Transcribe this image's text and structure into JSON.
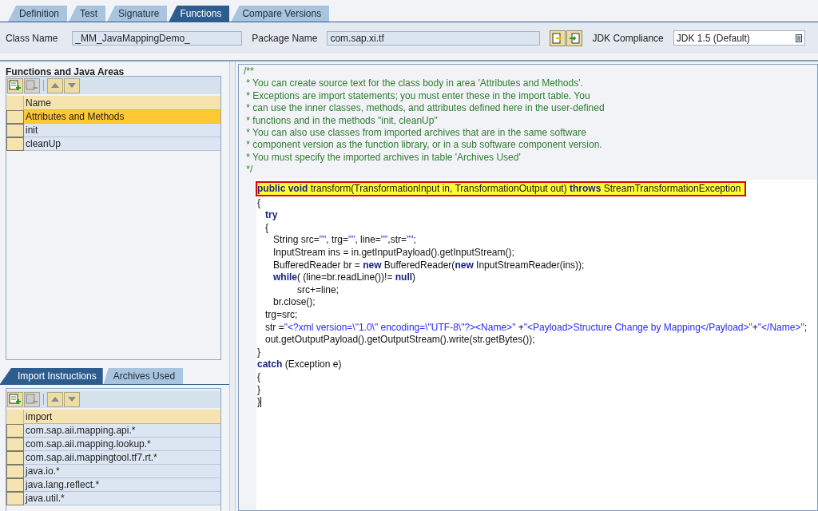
{
  "tabs": [
    {
      "label": "Definition",
      "selected": false
    },
    {
      "label": "Test",
      "selected": false
    },
    {
      "label": "Signature",
      "selected": false
    },
    {
      "label": "Functions",
      "selected": true
    },
    {
      "label": "Compare Versions",
      "selected": false
    }
  ],
  "class_name": {
    "label": "Class Name",
    "value": "_MM_JavaMappingDemo_"
  },
  "package_name": {
    "label": "Package Name",
    "value": "com.sap.xi.tf"
  },
  "jdk_compliance": {
    "label": "JDK Compliance",
    "value": "JDK 1.5 (Default)"
  },
  "functions_panel": {
    "title": "Functions and Java Areas",
    "column": "Name",
    "rows": [
      {
        "text": "Attributes and Methods",
        "selected": true
      },
      {
        "text": "init",
        "selected": false
      },
      {
        "text": "cleanUp",
        "selected": false
      }
    ]
  },
  "bottom_tabs": [
    {
      "label": "Import Instructions",
      "selected": true
    },
    {
      "label": "Archives Used",
      "selected": false
    }
  ],
  "imports": {
    "column": "import",
    "rows": [
      {
        "text": "com.sap.aii.mapping.api.*",
        "selected": false
      },
      {
        "text": "com.sap.aii.mapping.lookup.*",
        "selected": false
      },
      {
        "text": "com.sap.aii.mappingtool.tf7.rt.*",
        "selected": false
      },
      {
        "text": "java.io.*",
        "selected": false
      },
      {
        "text": "java.lang.reflect.*",
        "selected": false
      },
      {
        "text": "java.util.*",
        "selected": false
      }
    ]
  },
  "editor": {
    "comment": [
      "/**",
      " * You can create source text for the class body in area 'Attributes and Methods'.",
      " * Exceptions are import statements; you must enter these in the import table. You",
      " * can use the inner classes, methods, and attributes defined here in the user-defined",
      " * functions and in the methods \"init, cleanUp\"",
      " * You can also use classes from imported archives that are in the same software",
      " * component version as the function library, or in a sub software component version.",
      " * You must specify the imported archives in table 'Archives Used'",
      " */"
    ],
    "code": [
      {
        "highlighted": true,
        "segments": [
          {
            "kind": "keyword",
            "text": "public void"
          },
          {
            "kind": "plain",
            "text": " transform(TransformationInput in, TransformationOutput out) "
          },
          {
            "kind": "keyword",
            "text": "throws"
          },
          {
            "kind": "plain",
            "text": " StreamTransformationException"
          }
        ]
      },
      {
        "highlighted": false,
        "segments": [
          {
            "kind": "plain",
            "text": "{"
          }
        ]
      },
      {
        "highlighted": false,
        "segments": [
          {
            "kind": "keyword",
            "text": "   try"
          }
        ]
      },
      {
        "highlighted": false,
        "segments": [
          {
            "kind": "plain",
            "text": "   {"
          }
        ]
      },
      {
        "highlighted": false,
        "segments": [
          {
            "kind": "plain",
            "text": "      String src="
          },
          {
            "kind": "string",
            "text": "\"\""
          },
          {
            "kind": "plain",
            "text": ", trg="
          },
          {
            "kind": "string",
            "text": "\"\""
          },
          {
            "kind": "plain",
            "text": ", line="
          },
          {
            "kind": "string",
            "text": "\"\""
          },
          {
            "kind": "plain",
            "text": ",str="
          },
          {
            "kind": "string",
            "text": "\"\""
          },
          {
            "kind": "plain",
            "text": ";"
          }
        ]
      },
      {
        "highlighted": false,
        "segments": [
          {
            "kind": "plain",
            "text": "      InputStream ins = in.getInputPayload().getInputStream();"
          }
        ]
      },
      {
        "highlighted": false,
        "segments": [
          {
            "kind": "plain",
            "text": "      BufferedReader br = "
          },
          {
            "kind": "keyword",
            "text": "new"
          },
          {
            "kind": "plain",
            "text": " BufferedReader("
          },
          {
            "kind": "keyword",
            "text": "new"
          },
          {
            "kind": "plain",
            "text": " InputStreamReader(ins));"
          }
        ]
      },
      {
        "highlighted": false,
        "segments": [
          {
            "kind": "keyword",
            "text": "      while"
          },
          {
            "kind": "plain",
            "text": "( (line=br.readLine())!= "
          },
          {
            "kind": "keyword",
            "text": "null"
          },
          {
            "kind": "plain",
            "text": ")"
          }
        ]
      },
      {
        "highlighted": false,
        "segments": [
          {
            "kind": "plain",
            "text": "               src+=line;"
          }
        ]
      },
      {
        "highlighted": false,
        "segments": [
          {
            "kind": "plain",
            "text": "      br.close();"
          }
        ]
      },
      {
        "highlighted": false,
        "segments": [
          {
            "kind": "plain",
            "text": "   trg=src;"
          }
        ]
      },
      {
        "highlighted": false,
        "segments": [
          {
            "kind": "plain",
            "text": "   str ="
          },
          {
            "kind": "string",
            "text": "\"<?xml version=\\\"1.0\\\" encoding=\\\"UTF-8\\\"?><Name>\""
          },
          {
            "kind": "plain",
            "text": " +"
          },
          {
            "kind": "string",
            "text": "\"<Payload>Structure Change by Mapping</Payload>\""
          },
          {
            "kind": "plain",
            "text": "+"
          },
          {
            "kind": "string",
            "text": "\"</Name>\""
          },
          {
            "kind": "plain",
            "text": ";"
          }
        ]
      },
      {
        "highlighted": false,
        "segments": [
          {
            "kind": "plain",
            "text": "   out.getOutputPayload().getOutputStream().write(str.getBytes());"
          }
        ]
      },
      {
        "highlighted": false,
        "segments": [
          {
            "kind": "plain",
            "text": "}"
          }
        ]
      },
      {
        "highlighted": false,
        "segments": [
          {
            "kind": "keyword",
            "text": "catch"
          },
          {
            "kind": "plain",
            "text": " (Exception e)"
          }
        ]
      },
      {
        "highlighted": false,
        "segments": [
          {
            "kind": "plain",
            "text": "{"
          }
        ]
      },
      {
        "highlighted": false,
        "segments": [
          {
            "kind": "plain",
            "text": "}"
          }
        ]
      },
      {
        "highlighted": false,
        "segments": [
          {
            "kind": "plain",
            "text": "}"
          }
        ]
      }
    ]
  }
}
